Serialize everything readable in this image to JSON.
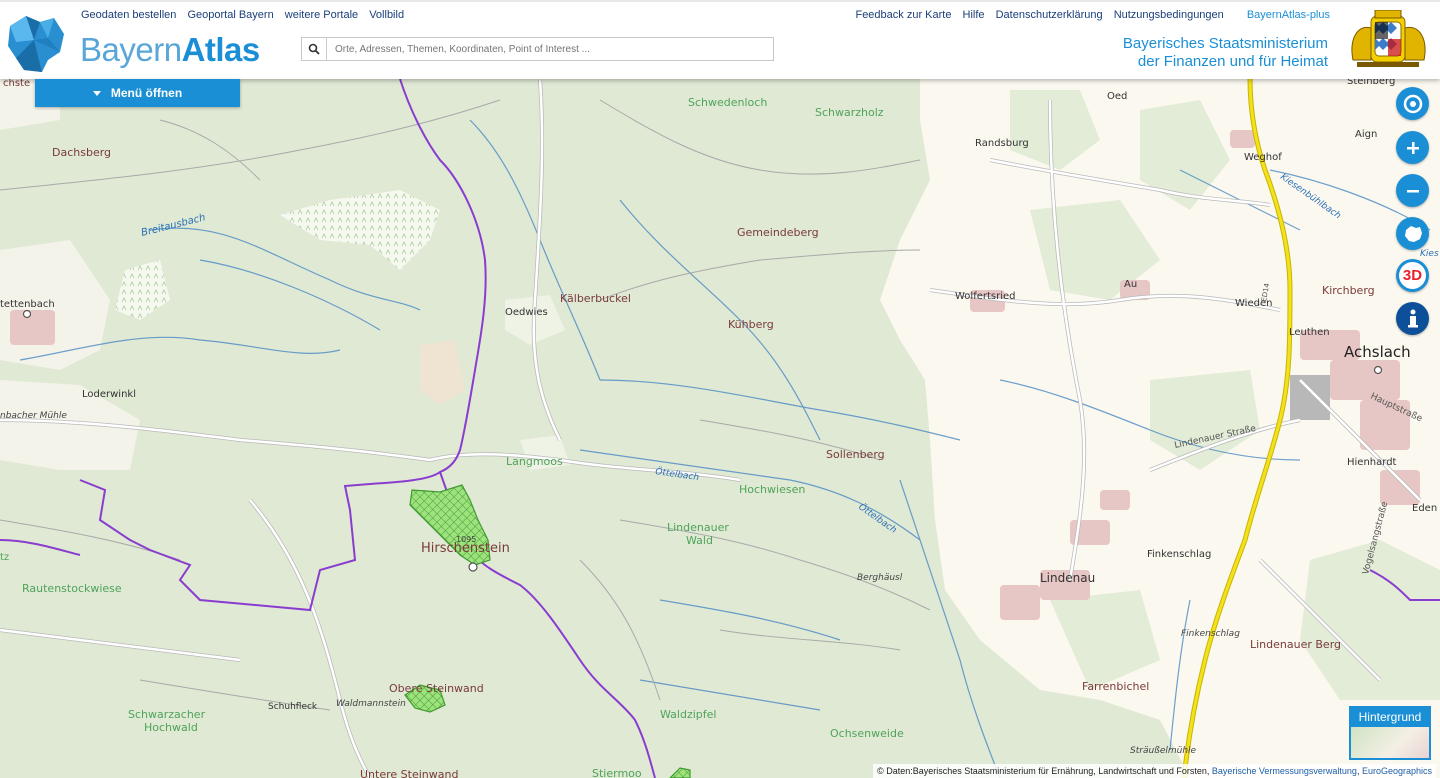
{
  "header": {
    "links_left": [
      "Geodaten bestellen",
      "Geoportal Bayern",
      "weitere Portale",
      "Vollbild"
    ],
    "links_right": [
      "Feedback zur Karte",
      "Hilfe",
      "Datenschutzerklärung",
      "Nutzungsbedingungen"
    ],
    "plus_link": "BayernAtlas-plus",
    "logo_light": "Bayern",
    "logo_bold": "Atlas",
    "ministry_line1": "Bayerisches Staatsministerium",
    "ministry_line2": "der Finanzen und für Heimat"
  },
  "search": {
    "placeholder": "Orte, Adressen, Themen, Koordinaten, Point of Interest ..."
  },
  "menu": {
    "label": "Menü öffnen"
  },
  "controls": [
    "locate-icon",
    "zoom-in-icon",
    "zoom-out-icon",
    "bavaria-icon",
    "3d-icon",
    "info-icon"
  ],
  "controls_3d_label": "3D",
  "background_switch": {
    "label": "Hintergrund"
  },
  "attribution": {
    "text": "© Daten:Bayerisches Staatsministerium für Ernährung, Landwirtschaft und Forsten, ",
    "link1": "Bayerische Vermessungsverwaltung",
    "sep": ", ",
    "link2": "EuroGeographics"
  },
  "places": {
    "dachsberg": "Dachsberg",
    "schwedenloch": "Schwedenloch",
    "schwarzholz": "Schwarzholz",
    "oed": "Oed",
    "steinberg": "Steinberg",
    "randsburg": "Randsburg",
    "aign": "Aign",
    "weghof": "Weghof",
    "breitausbach": "Breitausbach",
    "kiesenbuehlbach": "Kiesenbühlbach",
    "gemeindeberg": "Gemeindeberg",
    "kies": "Kies",
    "stettenbach": "tettenbach",
    "oedwies": "Oedwies",
    "kaelberbuckel": "Kälberbuckel",
    "wolfertsried": "Wolfertsried",
    "au": "Au",
    "wieden": "Wieden",
    "kirchberg": "Kirchberg",
    "kuehberg": "Kühberg",
    "leuthen": "Leuthen",
    "achslach": "Achslach",
    "loderwinkl": "Loderwinkl",
    "hauptstrasse": "Hauptstraße",
    "muehle": "nbacher Mühle",
    "lindenauer_strasse": "Lindenauer Straße",
    "hienhardt": "Hienhardt",
    "sollenberg": "Sollenberg",
    "langmoos": "Langmoos",
    "oettelbach1": "Öttelbach",
    "hochwiesen": "Hochwiesen",
    "oettelbach2": "Öttelbach",
    "eden": "Eden",
    "lindenauer_wald_1": "Lindenauer",
    "lindenauer_wald_2": "Wald",
    "hirschenstein": "Hirschenstein",
    "hoehe": "1095",
    "finkenschlag1": "Finkenschlag",
    "vogelsangstrasse": "Vogelsangstraße",
    "berghaeusl": "Berghäusl",
    "lindenau": "Lindenau",
    "tz": "tz",
    "rautenstockwiese": "Rautenstockwiese",
    "finkenschlag2": "Finkenschlag",
    "lindenauer_berg": "Lindenauer Berg",
    "obere_steinwand": "Obere Steinwand",
    "farrenbichel": "Farrenbichel",
    "schuhfleck": "Schuhfleck",
    "waldmannstein": "Waldmannstein",
    "schwarzacher_1": "Schwarzacher",
    "schwarzacher_2": "Hochwald",
    "waldzipfel": "Waldzipfel",
    "ochsenweide": "Ochsenweide",
    "straesselmuehle": "Sträußelmühle",
    "untere_steinwand": "Untere Steinwand",
    "stiermoos": "Stiermoo",
    "road_b": "ED14",
    "hochste": "chste"
  },
  "colors": {
    "accent": "#1a8fd6",
    "forest": "#dfe9d4",
    "open_land": "#fbf8ef",
    "water": "#4a88c4",
    "border": "#8a3ccf",
    "main_road": "#f2e11c",
    "forest_area": "#7fd86a"
  }
}
